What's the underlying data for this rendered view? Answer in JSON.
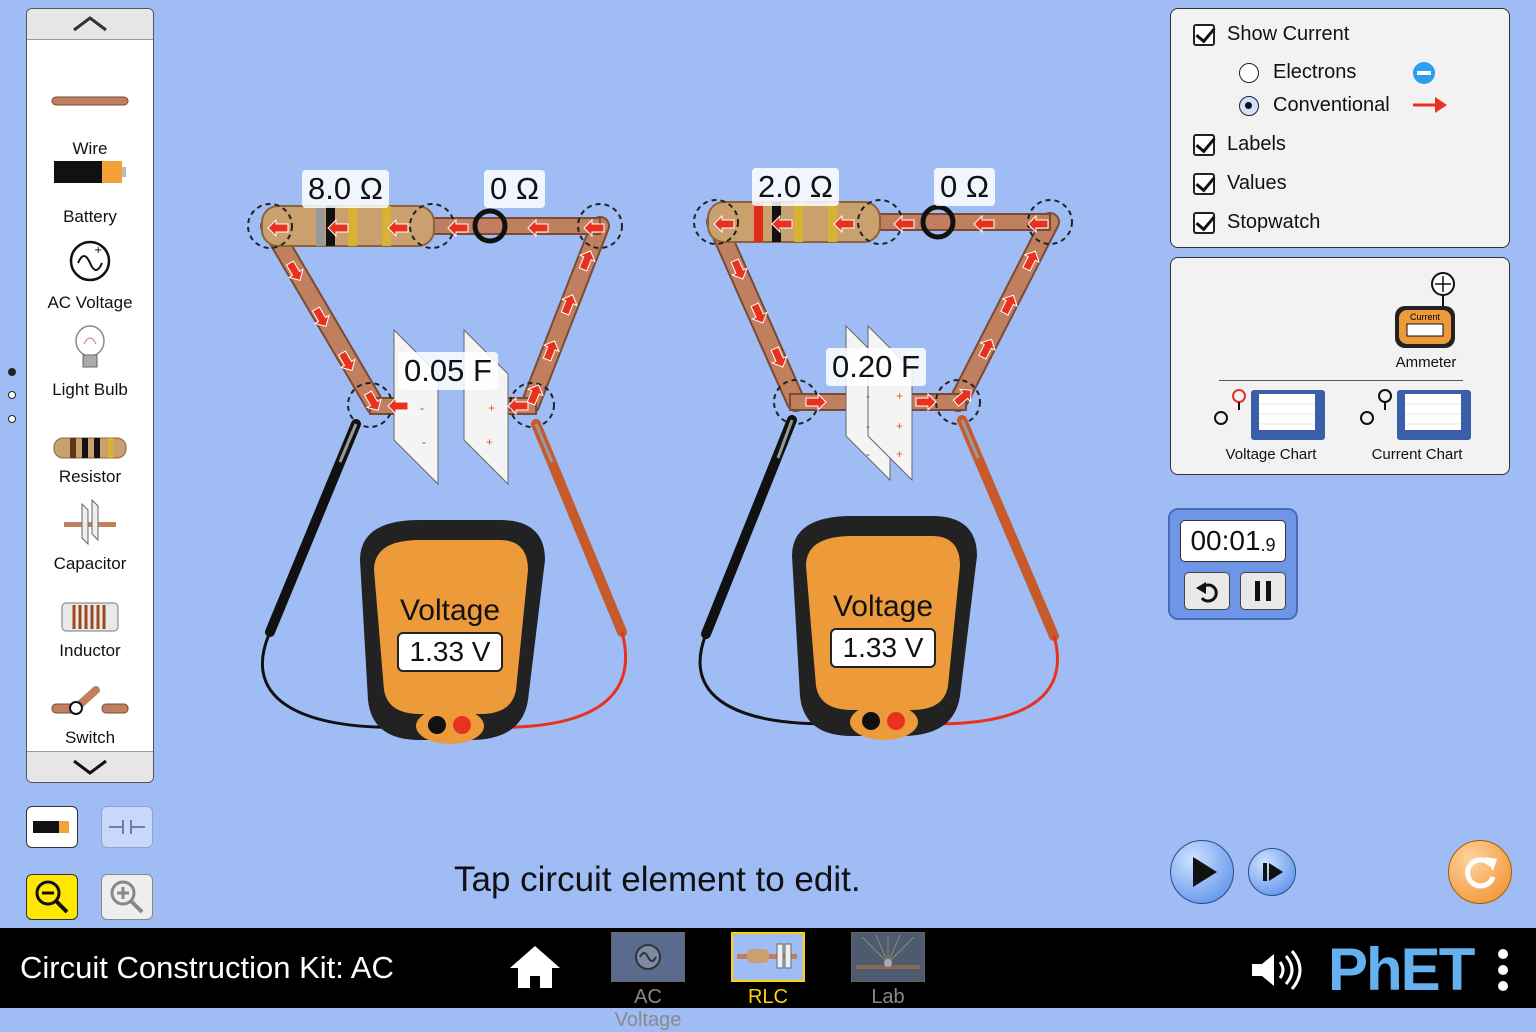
{
  "toolbox": {
    "items": [
      {
        "label": "Wire"
      },
      {
        "label": "Battery"
      },
      {
        "label": "AC Voltage"
      },
      {
        "label": "Light Bulb"
      },
      {
        "label": "Resistor"
      },
      {
        "label": "Capacitor"
      },
      {
        "label": "Inductor"
      },
      {
        "label": "Switch"
      }
    ]
  },
  "circuits": [
    {
      "resistor_label": "8.0 Ω",
      "switch_label": "0 Ω",
      "capacitor_label": "0.05 F",
      "meter": {
        "title": "Voltage",
        "reading": "1.33 V"
      }
    },
    {
      "resistor_label": "2.0 Ω",
      "switch_label": "0 Ω",
      "capacitor_label": "0.20 F",
      "meter": {
        "title": "Voltage",
        "reading": "1.33 V"
      }
    }
  ],
  "display_options": {
    "show_current": "Show Current",
    "electrons": "Electrons",
    "conventional": "Conventional",
    "current_mode": "conventional",
    "labels": "Labels",
    "values": "Values",
    "stopwatch": "Stopwatch",
    "checked": {
      "show_current": true,
      "labels": true,
      "values": true,
      "stopwatch": true
    }
  },
  "instruments": {
    "ammeter": "Ammeter",
    "ammeter_face": "Current",
    "voltage_chart": "Voltage Chart",
    "current_chart": "Current Chart"
  },
  "stopwatch": {
    "time_main": "00:01",
    "time_fraction": ".9"
  },
  "hint": "Tap circuit element to edit.",
  "navbar": {
    "title": "Circuit Construction Kit: AC",
    "tabs": [
      {
        "label": "AC Voltage",
        "active": false
      },
      {
        "label": "RLC",
        "active": true
      },
      {
        "label": "Lab",
        "active": false
      }
    ],
    "brand": "PhET"
  },
  "colors": {
    "background": "#9fbcf5",
    "wire": "#c0805f",
    "current_arrow": "#e8321e",
    "meter_orange": "#ec9a3a",
    "active_tab": "#ffd200",
    "reset": "#f08c22",
    "play": "#4a86e8"
  }
}
